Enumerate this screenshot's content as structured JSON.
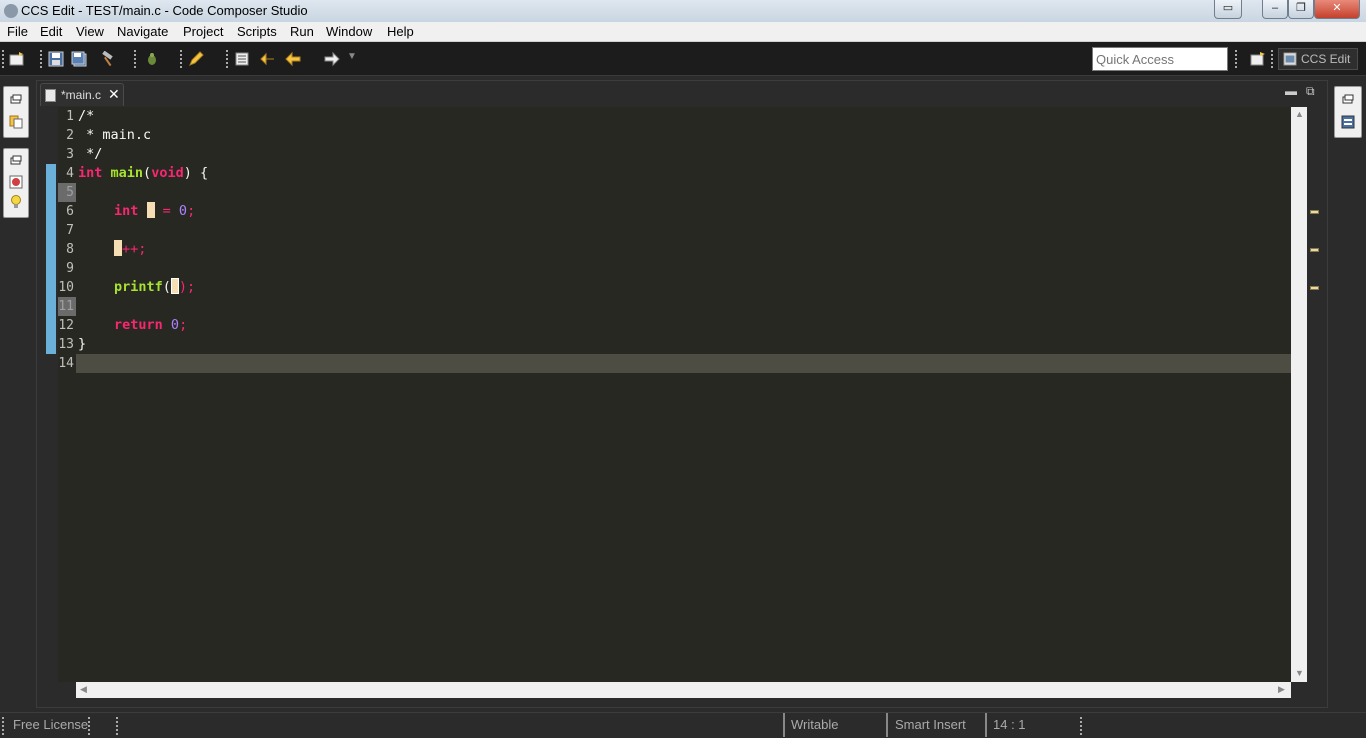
{
  "window": {
    "title": "CCS Edit - TEST/main.c - Code Composer Studio"
  },
  "menu": {
    "items": [
      "File",
      "Edit",
      "View",
      "Navigate",
      "Project",
      "Scripts",
      "Run",
      "Window",
      "Help"
    ]
  },
  "toolbar": {
    "quick_access_placeholder": "Quick Access",
    "perspective_label": "CCS Edit"
  },
  "editor": {
    "tab_label": "*main.c",
    "line_numbers": [
      "1",
      "2",
      "3",
      "4",
      "5",
      "6",
      "7",
      "8",
      "9",
      "10",
      "11",
      "12",
      "13",
      "14"
    ],
    "lines": {
      "l1": "/*",
      "l2": " * main.c",
      "l3": " */",
      "l4_kw": "int",
      "l4_fn": "main",
      "l4_p1": "(",
      "l4_kw2": "void",
      "l4_p2": ") {",
      "l6_kw": "int",
      "l6_eq": " = ",
      "l6_num": "0",
      "l6_end": ";",
      "l8_op": "++;",
      "l10_fn": "printf",
      "l10_p1": "(",
      "l10_end": ");",
      "l12_kw": "return",
      "l12_num": "0",
      "l12_end": ";",
      "l13": "}"
    },
    "colors": {
      "background": "#272822",
      "keyword": "#f92672",
      "function": "#a6e22e",
      "number": "#ae81ff"
    }
  },
  "statusbar": {
    "license": "Free License",
    "writable": "Writable",
    "insert_mode": "Smart Insert",
    "position": "14 : 1"
  }
}
